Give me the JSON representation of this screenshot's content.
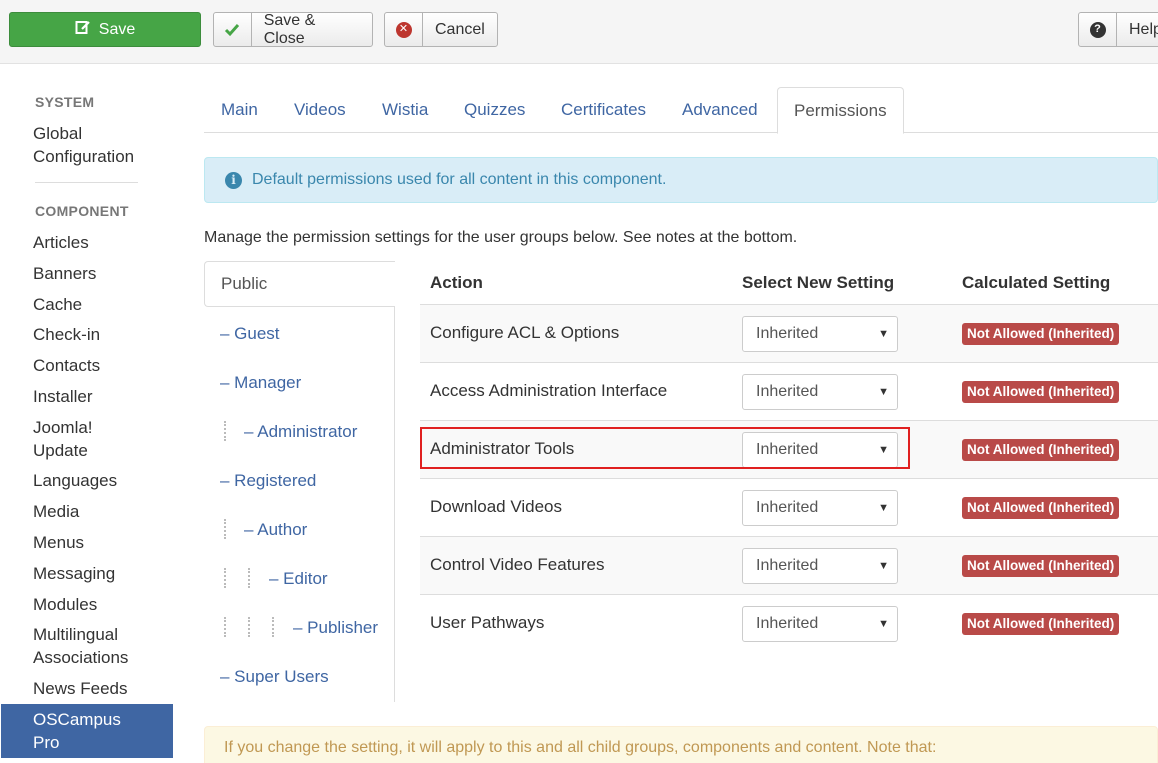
{
  "toolbar": {
    "save_label": "Save",
    "save_close_label": "Save & Close",
    "cancel_label": "Cancel",
    "help_label": "Help"
  },
  "sidebar": {
    "system_heading": "SYSTEM",
    "global_config": "Global Configuration",
    "component_heading": "COMPONENT",
    "items": [
      "Articles",
      "Banners",
      "Cache",
      "Check-in",
      "Contacts",
      "Installer",
      "Joomla! Update",
      "Languages",
      "Media",
      "Menus",
      "Messaging",
      "Modules",
      "Multilingual Associations",
      "News Feeds"
    ],
    "active_item": "OSCampus Pro"
  },
  "tabs": [
    "Main",
    "Videos",
    "Wistia",
    "Quizzes",
    "Certificates",
    "Advanced",
    "Permissions"
  ],
  "info_text": "Default permissions used for all content in this component.",
  "manage_text": "Manage the permission settings for the user groups below. See notes at the bottom.",
  "groups": {
    "public": "Public",
    "list": [
      "– Guest",
      "– Manager",
      "– Administrator",
      "– Registered",
      "– Author",
      "– Editor",
      "– Publisher",
      "– Super Users"
    ]
  },
  "table": {
    "headers": [
      "Action",
      "Select New Setting",
      "Calculated Setting"
    ],
    "rows": [
      {
        "action": "Configure ACL & Options",
        "setting": "Inherited",
        "calculated": "Not Allowed (Inherited)"
      },
      {
        "action": "Access Administration Interface",
        "setting": "Inherited",
        "calculated": "Not Allowed (Inherited)"
      },
      {
        "action": "Administrator Tools",
        "setting": "Inherited",
        "calculated": "Not Allowed (Inherited)"
      },
      {
        "action": "Download Videos",
        "setting": "Inherited",
        "calculated": "Not Allowed (Inherited)"
      },
      {
        "action": "Control Video Features",
        "setting": "Inherited",
        "calculated": "Not Allowed (Inherited)"
      },
      {
        "action": "User Pathways",
        "setting": "Inherited",
        "calculated": "Not Allowed (Inherited)"
      }
    ]
  },
  "warning_text": "If you change the setting, it will apply to this and all child groups, components and content. Note that:",
  "colors": {
    "save_green": "#46a546",
    "link_blue": "#3f66a3",
    "badge_red": "#b94a48",
    "highlight_red": "#e02020"
  }
}
